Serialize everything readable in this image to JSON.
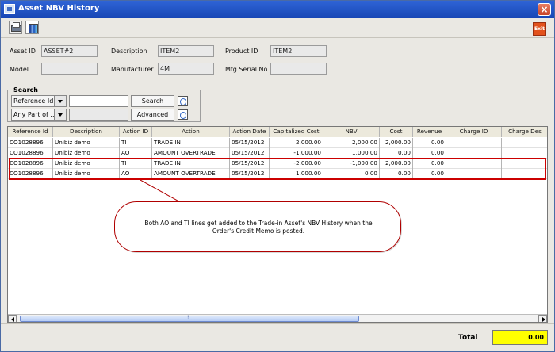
{
  "window": {
    "title": "Asset NBV History",
    "close_symbol": "×"
  },
  "toolbar": {
    "exit_label": "Exit"
  },
  "asset": {
    "asset_id_label": "Asset ID",
    "asset_id": "ASSET#2",
    "description_label": "Description",
    "description": "ITEM2",
    "product_id_label": "Product ID",
    "product_id": "ITEM2",
    "model_label": "Model",
    "model": "",
    "manufacturer_label": "Manufacturer",
    "manufacturer": "4M",
    "serial_label": "Mfg Serial No",
    "serial": ""
  },
  "search": {
    "title": "Search",
    "field_select": "Reference Id",
    "match_select": "Any Part of ...",
    "search_button": "Search",
    "advanced_button": "Advanced"
  },
  "table": {
    "columns": [
      "Reference Id",
      "Description",
      "Action ID",
      "Action",
      "Action Date",
      "Capitalized Cost",
      "NBV",
      "Cost",
      "Revenue",
      "Charge ID",
      "Charge Des"
    ],
    "rows": [
      [
        "CO1028896",
        "Unibiz demo",
        "TI",
        "TRADE IN",
        "05/15/2012",
        "2,000.00",
        "2,000.00",
        "2,000.00",
        "0.00",
        "",
        ""
      ],
      [
        "CO1028896",
        "Unibiz demo",
        "AO",
        "AMOUNT OVERTRADE",
        "05/15/2012",
        "-1,000.00",
        "1,000.00",
        "0.00",
        "0.00",
        "",
        ""
      ],
      [
        "CO1028896",
        "Unibiz demo",
        "TI",
        "TRADE IN",
        "05/15/2012",
        "-2,000.00",
        "-1,000.00",
        "2,000.00",
        "0.00",
        "",
        ""
      ],
      [
        "CO1028896",
        "Unibiz demo",
        "AO",
        "AMOUNT OVERTRADE",
        "05/15/2012",
        "1,000.00",
        "0.00",
        "0.00",
        "0.00",
        "",
        ""
      ]
    ]
  },
  "callout": {
    "text": "Both AO and TI lines get added to the Trade-in Asset's NBV History when the Order's Credit Memo is posted."
  },
  "footer": {
    "total_label": "Total",
    "total_value": "0.00"
  },
  "colors": {
    "highlight": "#cc0000",
    "total_background": "#ffff00",
    "titlebar": "#1746b5"
  }
}
